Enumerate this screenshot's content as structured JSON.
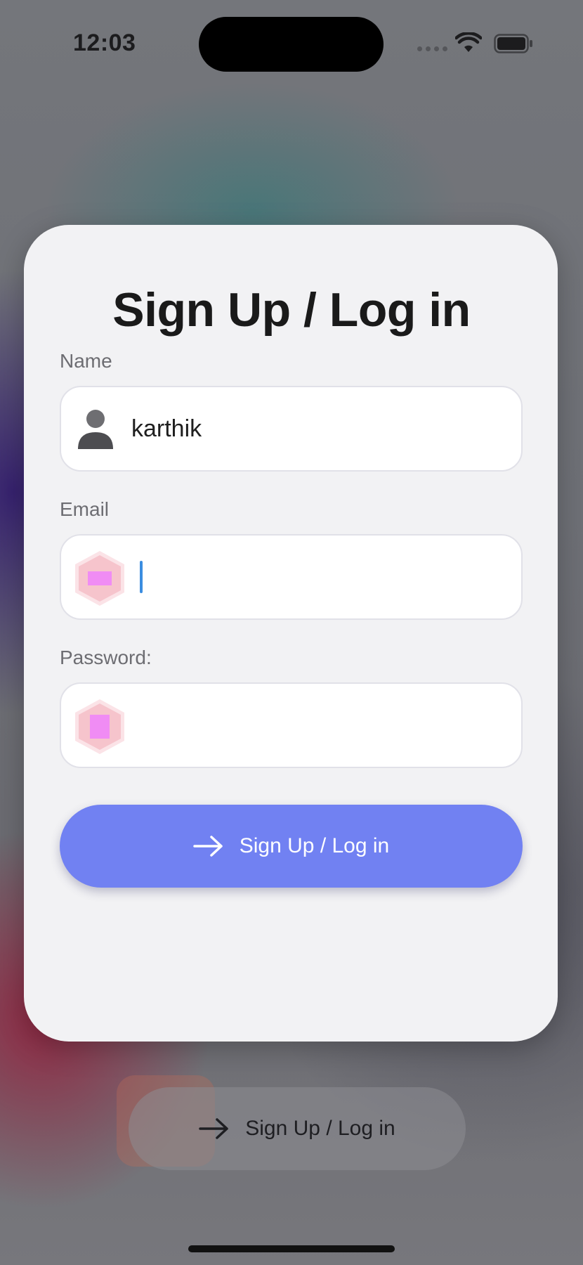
{
  "status_bar": {
    "time": "12:03",
    "icons": [
      "signal-dots-icon",
      "wifi-icon",
      "battery-icon"
    ]
  },
  "form": {
    "title": "Sign Up / Log in",
    "name": {
      "label": "Name",
      "value": "karthik",
      "icon": "person-icon"
    },
    "email": {
      "label": "Email",
      "value": "",
      "icon": "hexagon-placeholder-icon"
    },
    "password": {
      "label": "Password:",
      "value": "",
      "icon": "hexagon-placeholder-icon"
    },
    "submit_label": "Sign Up / Log in",
    "submit_icon": "arrow-right-icon"
  },
  "background_button": {
    "label": "Sign Up / Log in",
    "icon": "arrow-right-icon"
  },
  "colors": {
    "primary_button": "#7181f2",
    "caret": "#3b8de0",
    "placeholder_icon_pink": "#f6c4cc",
    "placeholder_icon_magenta": "#f08cf4"
  }
}
